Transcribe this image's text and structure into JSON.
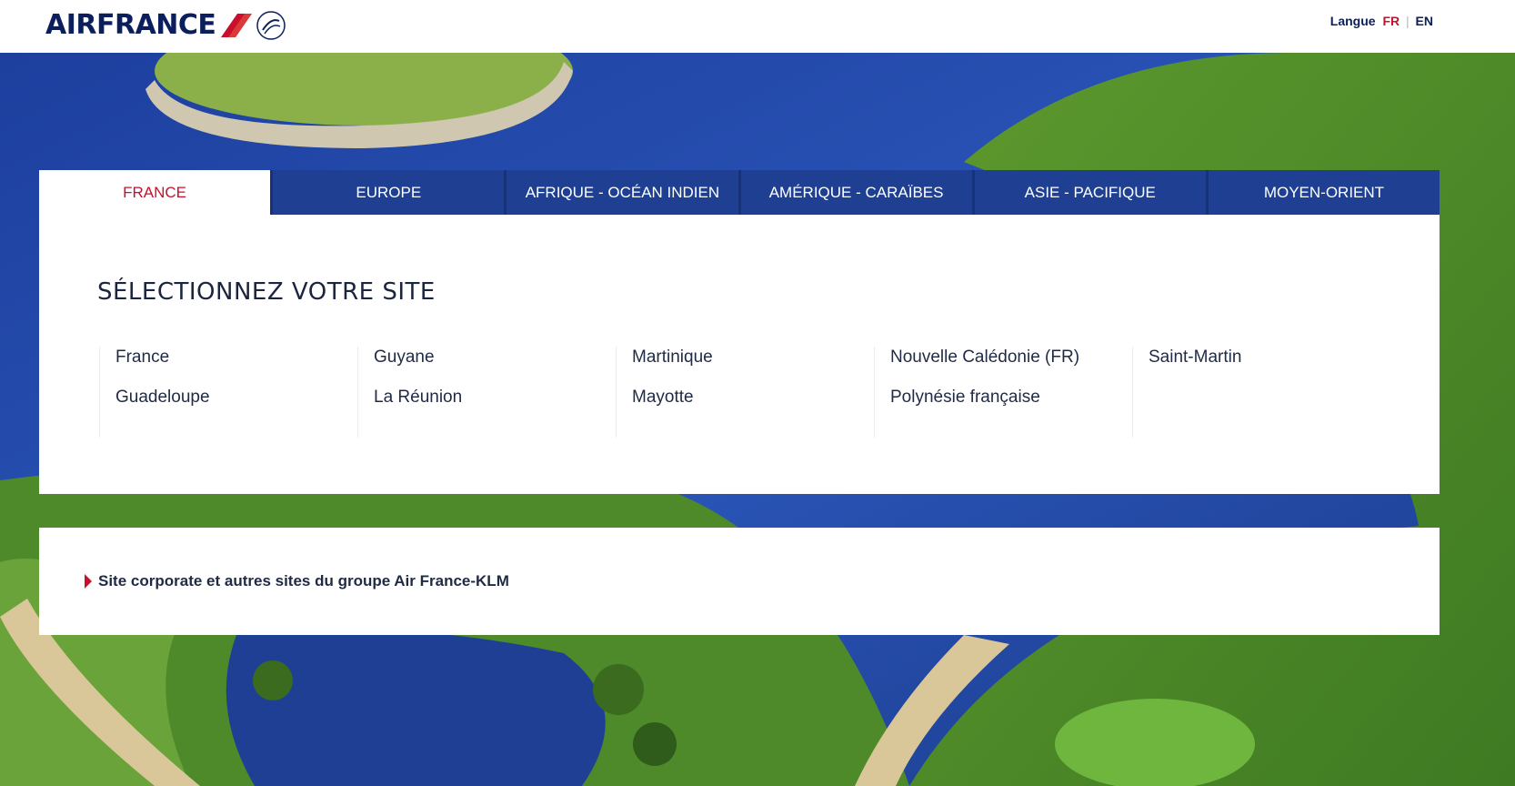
{
  "header": {
    "brand": "AIRFRANCE",
    "language_label": "Langue",
    "lang_fr": "FR",
    "lang_en": "EN"
  },
  "tabs": [
    {
      "label": "FRANCE",
      "active": true
    },
    {
      "label": "EUROPE",
      "active": false
    },
    {
      "label": "AFRIQUE - OCÉAN INDIEN",
      "active": false
    },
    {
      "label": "AMÉRIQUE - CARAÏBES",
      "active": false
    },
    {
      "label": "ASIE - PACIFIQUE",
      "active": false
    },
    {
      "label": "MOYEN-ORIENT",
      "active": false
    }
  ],
  "main": {
    "title": "SÉLECTIONNEZ VOTRE SITE",
    "columns": [
      [
        "France",
        "Guadeloupe"
      ],
      [
        "Guyane",
        "La Réunion"
      ],
      [
        "Martinique",
        "Mayotte"
      ],
      [
        "Nouvelle Calédonie (FR)",
        "Polynésie française"
      ],
      [
        "Saint-Martin"
      ]
    ]
  },
  "footer": {
    "corporate_link": "Site corporate et autres sites du groupe Air France-KLM"
  },
  "colors": {
    "brand_navy": "#0a1f5c",
    "accent_red": "#c8102e",
    "tab_blue": "#1e3f92"
  }
}
